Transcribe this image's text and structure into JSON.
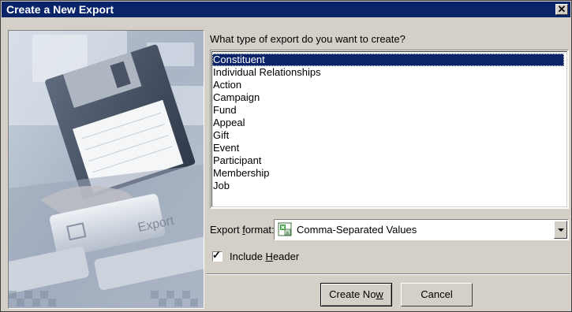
{
  "window": {
    "title": "Create a New Export",
    "close_icon": "close-icon"
  },
  "banner": {
    "image": "floppy-disk-export-artwork",
    "art_text": "Export"
  },
  "prompt": "What type of export do you want to create?",
  "export_types": [
    {
      "label": "Constituent",
      "selected": true
    },
    {
      "label": "Individual Relationships",
      "selected": false
    },
    {
      "label": "Action",
      "selected": false
    },
    {
      "label": "Campaign",
      "selected": false
    },
    {
      "label": "Fund",
      "selected": false
    },
    {
      "label": "Appeal",
      "selected": false
    },
    {
      "label": "Gift",
      "selected": false
    },
    {
      "label": "Event",
      "selected": false
    },
    {
      "label": "Participant",
      "selected": false
    },
    {
      "label": "Membership",
      "selected": false
    },
    {
      "label": "Job",
      "selected": false
    }
  ],
  "format": {
    "label_pre": "Export ",
    "label_accel": "f",
    "label_post": "ormat:",
    "value": "Comma-Separated Values",
    "icon": "excel-csv-icon"
  },
  "include_header": {
    "checked": true,
    "label_pre": "Include ",
    "label_accel": "H",
    "label_post": "eader"
  },
  "buttons": {
    "create_pre": "Create No",
    "create_accel": "w",
    "cancel": "Cancel"
  },
  "colors": {
    "title_bar": "#0a246a",
    "selection": "#0a246a",
    "dialog_face": "#d4d0c8"
  }
}
